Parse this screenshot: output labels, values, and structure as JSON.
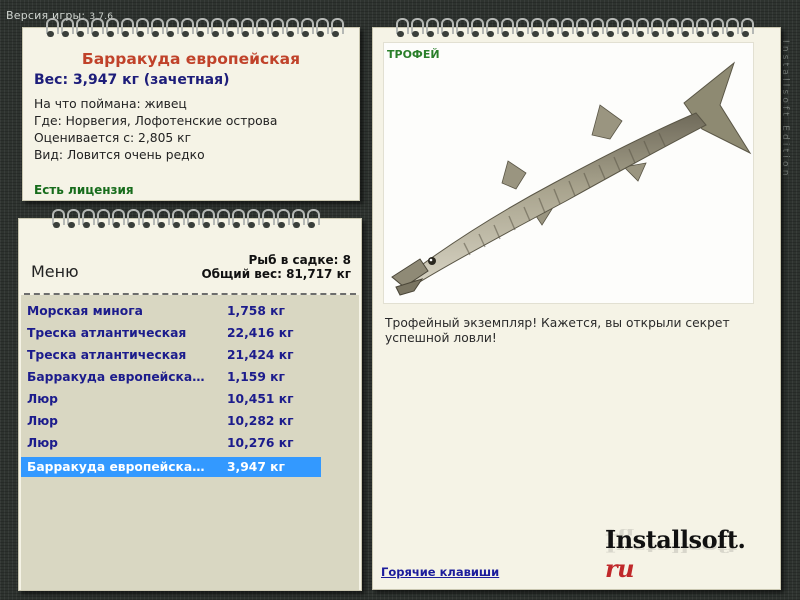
{
  "app": {
    "version_label": "Версия игры:",
    "version": "3.7.6",
    "side_text": "Installsoft Edition"
  },
  "info": {
    "title": "Барракуда европейская",
    "weight": "Вес: 3,947 кг (зачетная)",
    "lines": [
      "На что поймана: живец",
      "Где: Норвегия, Лофотенские острова",
      "Оценивается с: 2,805 кг",
      "Вид: Ловится очень редко"
    ],
    "license": "Есть лицензия"
  },
  "catch": {
    "count": "Рыб в садке: 8",
    "total": "Общий вес: 81,717 кг",
    "menu_label": "Меню",
    "rows": [
      {
        "name": "Морская минога",
        "weight": "1,758 кг"
      },
      {
        "name": "Треска атлантическая",
        "weight": "22,416 кг"
      },
      {
        "name": "Треска атлантическая",
        "weight": "21,424 кг"
      },
      {
        "name": "Барракуда европейска…",
        "weight": "1,159 кг"
      },
      {
        "name": "Люр",
        "weight": "10,451 кг"
      },
      {
        "name": "Люр",
        "weight": "10,282 кг"
      },
      {
        "name": "Люр",
        "weight": "10,276 кг"
      },
      {
        "name": "Барракуда европейска…",
        "weight": "3,947 кг"
      }
    ],
    "selected_index": 7
  },
  "trophy": {
    "tag": "ТРОФЕЙ",
    "desc": "Трофейный экземпляр! Кажется, вы открыли секрет успешной ловли!",
    "hotkeys": "Горячие клавиши",
    "brand_main": "Installsoft.",
    "brand_ru": "ru"
  },
  "colors": {
    "selection": "#3399ff",
    "title": "#c0422a",
    "license": "#176c1c",
    "link": "#1c1c9c"
  }
}
